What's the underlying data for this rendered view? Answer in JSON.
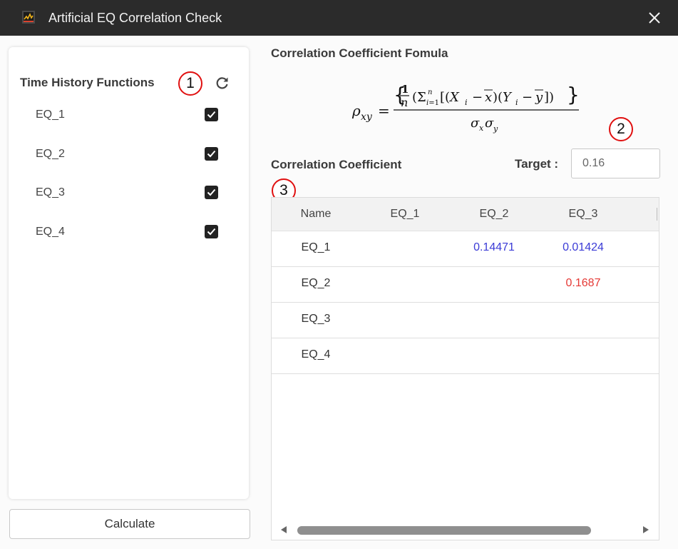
{
  "window": {
    "title": "Artificial EQ Correlation Check"
  },
  "left_panel": {
    "title": "Time History Functions",
    "marker": "1",
    "functions": [
      {
        "label": "EQ_1",
        "checked": true
      },
      {
        "label": "EQ_2",
        "checked": true
      },
      {
        "label": "EQ_3",
        "checked": true
      },
      {
        "label": "EQ_4",
        "checked": true
      }
    ],
    "calculate_label": "Calculate"
  },
  "formula_section": {
    "heading": "Correlation Coefficient Fomula",
    "formula_text": "ρxy = {1/n (Σ(i=1..n) [(Xi − x̄)(Yi − ȳ)])} / σxσy",
    "marker": "2"
  },
  "coefficient_section": {
    "heading": "Correlation Coefficient",
    "target_label": "Target :",
    "target_value": "0.16",
    "marker": "3"
  },
  "grid": {
    "columns": [
      "Name",
      "EQ_1",
      "EQ_2",
      "EQ_3"
    ],
    "rows": [
      {
        "name": "EQ_1",
        "eq_1": "",
        "eq_2": "0.14471",
        "eq_3": "0.01424"
      },
      {
        "name": "EQ_2",
        "eq_1": "",
        "eq_2": "",
        "eq_3": "0.1687"
      },
      {
        "name": "EQ_3",
        "eq_1": "",
        "eq_2": "",
        "eq_3": ""
      },
      {
        "name": "EQ_4",
        "eq_1": "",
        "eq_2": "",
        "eq_3": ""
      }
    ]
  },
  "colors": {
    "below_target": "#3b3bd6",
    "above_target": "#e53935",
    "title_bar": "#2b2b2b",
    "marker_border": "#e01010"
  }
}
